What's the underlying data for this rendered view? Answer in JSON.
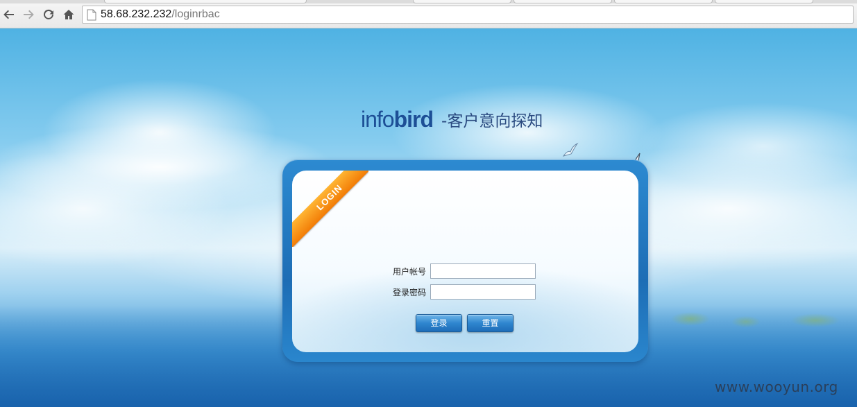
{
  "browser": {
    "url_host": "58.68.232.232",
    "url_path": "/loginrbac"
  },
  "logo": {
    "brand_part1": "info",
    "brand_part2": "bird",
    "tagline": "-客户意向探知"
  },
  "login": {
    "ribbon": "LOGIN",
    "username_label": "用户帐号",
    "username_value": "",
    "password_label": "登录密码",
    "password_value": "",
    "submit_label": "登录",
    "reset_label": "重置"
  },
  "watermark": "www.wooyun.org",
  "colors": {
    "brand": "#1d4f96",
    "panel_frame": "#1d6db5",
    "ribbon": "#f27c06",
    "button": "#2f86cf"
  }
}
